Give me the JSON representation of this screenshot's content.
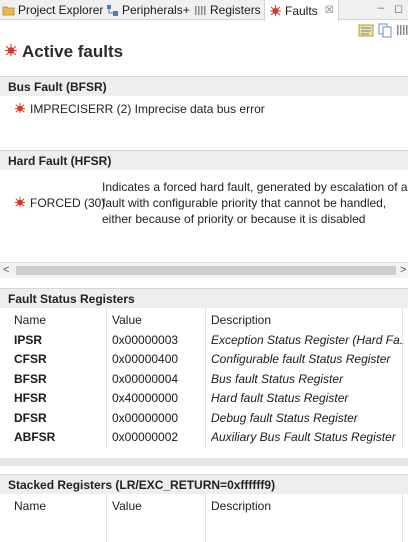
{
  "tabs": [
    {
      "label": "Project Explorer",
      "icon": "folder-icon"
    },
    {
      "label": "Peripherals+",
      "icon": "peripherals-icon"
    },
    {
      "label": "Registers",
      "icon": "registers-icon"
    },
    {
      "label": "Faults",
      "icon": "fault-bug-icon",
      "close": "☒"
    }
  ],
  "heading": "Active faults",
  "bus_fault": {
    "title": "Bus Fault (BFSR)",
    "entry_label": "IMPRECISERR (2) Imprecise data bus error"
  },
  "hard_fault": {
    "title": "Hard Fault (HFSR)",
    "entry_label": "FORCED (30)",
    "desc_lines": [
      "Indicates a forced hard fault, generated by escalation of a",
      "fault with configurable priority that cannot be handled,",
      "either because of priority or because it is disabled"
    ]
  },
  "scroll": {
    "left": "<",
    "right": ">"
  },
  "fault_status": {
    "title": "Fault Status Registers",
    "columns": [
      "Name",
      "Value",
      "Description"
    ],
    "rows": [
      {
        "name": "IPSR",
        "value": "0x00000003",
        "desc": "Exception Status Register (Hard Fa..."
      },
      {
        "name": "CFSR",
        "value": "0x00000400",
        "desc": "Configurable fault Status Register"
      },
      {
        "name": "BFSR",
        "value": "0x00000004",
        "desc": "Bus fault Status Register"
      },
      {
        "name": "HFSR",
        "value": "0x40000000",
        "desc": "Hard fault Status Register"
      },
      {
        "name": "DFSR",
        "value": "0x00000000",
        "desc": "Debug fault Status Register"
      },
      {
        "name": "ABFSR",
        "value": "0x00000002",
        "desc": "Auxiliary Bus Fault Status Register"
      }
    ]
  },
  "stacked": {
    "title": "Stacked Registers (LR/EXC_RETURN=0xffffff9)",
    "columns": [
      "Name",
      "Value",
      "Description"
    ]
  },
  "colors": {
    "accent_bug": "#d23a2a",
    "section_bg": "#eeeeee"
  }
}
